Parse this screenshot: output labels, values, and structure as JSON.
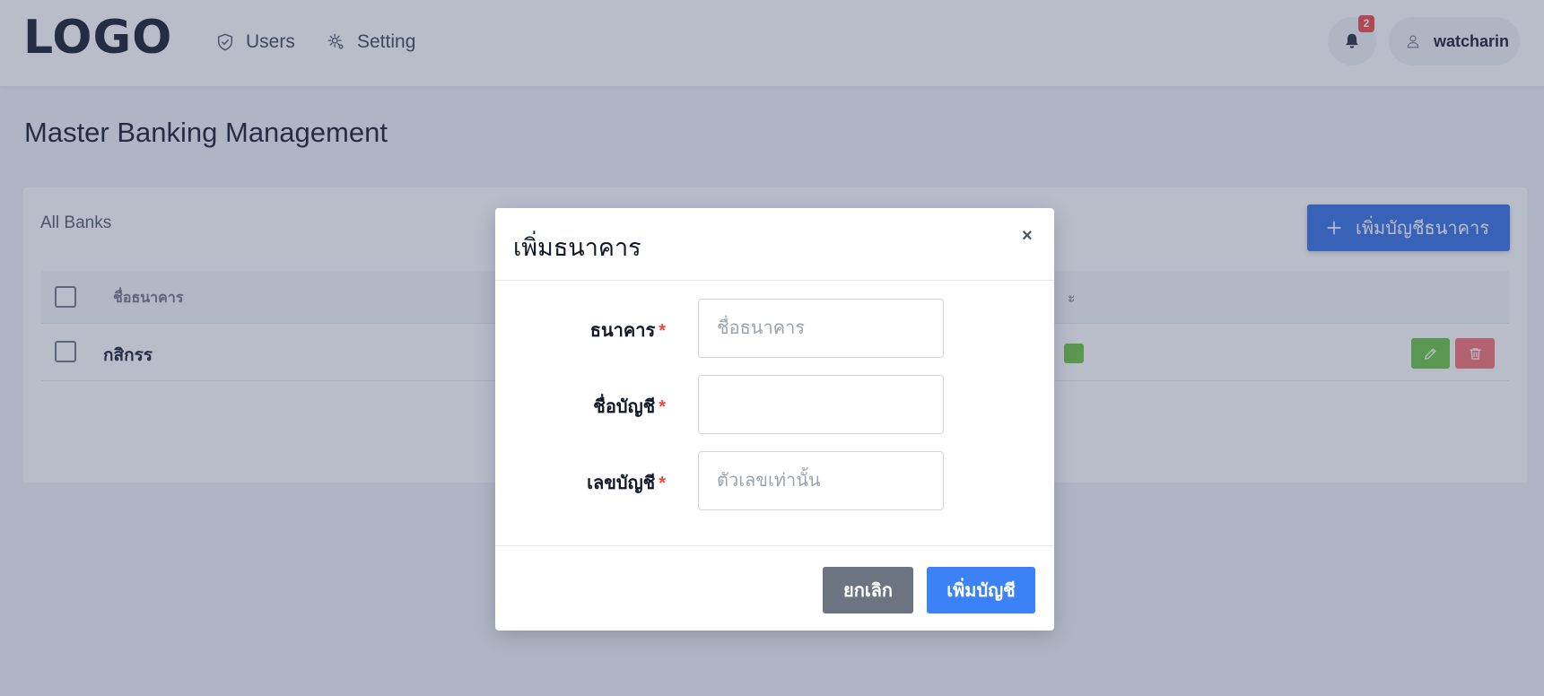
{
  "header": {
    "logo": "LOGO",
    "nav": [
      {
        "label": "Users",
        "icon": "shield-icon"
      },
      {
        "label": "Setting",
        "icon": "gear-icon"
      }
    ],
    "notifications": {
      "count": "2",
      "icon": "bell-icon"
    },
    "user": {
      "name": "watcharin",
      "icon": "user-icon"
    }
  },
  "page": {
    "title": "Master Banking Management"
  },
  "card": {
    "title": "All Banks",
    "add_button_label": "เพิ่มบัญชีธนาคาร",
    "table": {
      "columns": [
        "ชื่อธนาคาร",
        "ะ"
      ],
      "rows": [
        {
          "name": "กสิกรร",
          "status_color": "#67c23a"
        }
      ]
    }
  },
  "modal": {
    "title": "เพิ่มธนาคาร",
    "close": "×",
    "fields": [
      {
        "label": "ธนาคาร",
        "required": "*",
        "placeholder": "ชื่อธนาคาร",
        "value": ""
      },
      {
        "label": "ชื่อบัญชี",
        "required": "*",
        "placeholder": "",
        "value": ""
      },
      {
        "label": "เลขบัญชี",
        "required": "*",
        "placeholder": "ตัวเลขเท่านั้น",
        "value": ""
      }
    ],
    "cancel_label": "ยกเลิก",
    "submit_label": "เพิ่มบัญชี"
  },
  "colors": {
    "primary": "#2f6de1",
    "submit": "#3b82f6",
    "cancel": "#6b7480",
    "success": "#67c23a",
    "danger": "#f56c6c",
    "badge": "#ef4444"
  }
}
